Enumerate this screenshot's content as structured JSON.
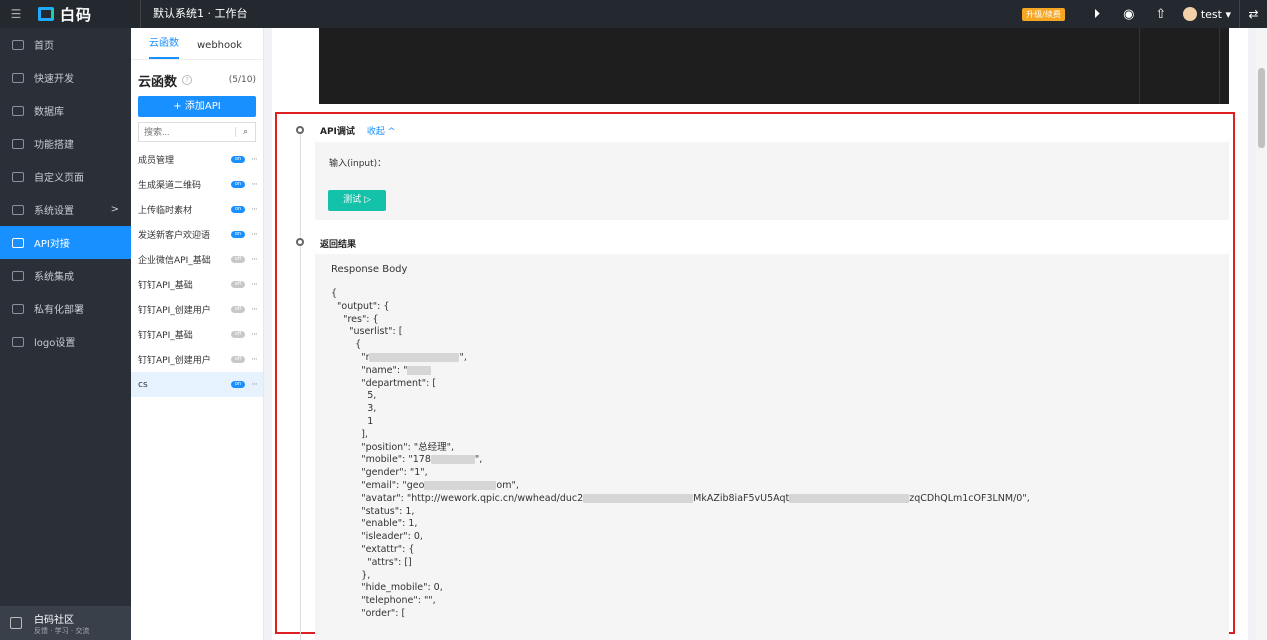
{
  "topbar": {
    "brand": "白码",
    "title": "默认系统1 · 工作台",
    "upgrade_label": "升级/续费",
    "user_name": "test ▾"
  },
  "sidebar": {
    "items": [
      {
        "label": "首页"
      },
      {
        "label": "快速开发"
      },
      {
        "label": "数据库"
      },
      {
        "label": "功能搭建"
      },
      {
        "label": "自定义页面"
      },
      {
        "label": "系统设置"
      },
      {
        "label": "API对接"
      },
      {
        "label": "系统集成"
      },
      {
        "label": "私有化部署"
      },
      {
        "label": "logo设置"
      }
    ],
    "arrow": ">",
    "community_title": "白码社区",
    "community_sub": "反馈 · 学习 · 交流"
  },
  "list_panel": {
    "tabs": [
      "云函数",
      "webhook"
    ],
    "title": "云函数",
    "count": "(5/10)",
    "add_button": "+ 添加API",
    "search_placeholder": "搜索...",
    "toggle_on": "on",
    "toggle_off": "off",
    "apis": [
      {
        "name": "成员管理",
        "status": "on"
      },
      {
        "name": "生成渠道二维码",
        "status": "on"
      },
      {
        "name": "上传临时素材",
        "status": "on"
      },
      {
        "name": "发送新客户欢迎语",
        "status": "on"
      },
      {
        "name": "企业微信API_基础",
        "status": "off"
      },
      {
        "name": "钉钉API_基础",
        "status": "off"
      },
      {
        "name": "钉钉API_创建用户",
        "status": "off"
      },
      {
        "name": "钉钉API_基础",
        "status": "off"
      },
      {
        "name": "钉钉API_创建用户",
        "status": "off"
      },
      {
        "name": "cs",
        "status": "on",
        "selected": true
      }
    ]
  },
  "main": {
    "api_test_title": "API调试",
    "collapse_label": "收起 ^",
    "input_label": "输入(input)：",
    "test_button": "测试 ▷",
    "result_title": "返回结果",
    "response_title": "Response Body",
    "json_lines": [
      "{",
      "  \"output\": {",
      "    \"res\": {",
      "      \"userlist\": [",
      "        {",
      "          \"r",
      "          \"name\": \"",
      "          \"department\": [",
      "            5,",
      "            3,",
      "            1",
      "          ],",
      "          \"position\": \"总经理\",",
      "          \"mobile\": \"178",
      "          \"gender\": \"1\",",
      "          \"email\": \"geo",
      "          \"avatar\": \"http://wework.qpic.cn/wwhead/duc2",
      "          \"status\": 1,",
      "          \"enable\": 1,",
      "          \"isleader\": 0,",
      "          \"extattr\": {",
      "            \"attrs\": []",
      "          },",
      "          \"hide_mobile\": 0,",
      "          \"telephone\": \"\",",
      "          \"order\": ["
    ],
    "json_tails": {
      "r": "\",",
      "mobile": "\",",
      "email": "om\",",
      "avatar": "zqCDhQLm1cOF3LNM/0\",",
      "avatar_mid": "MkAZib8iaF5vU5Aqt"
    }
  }
}
